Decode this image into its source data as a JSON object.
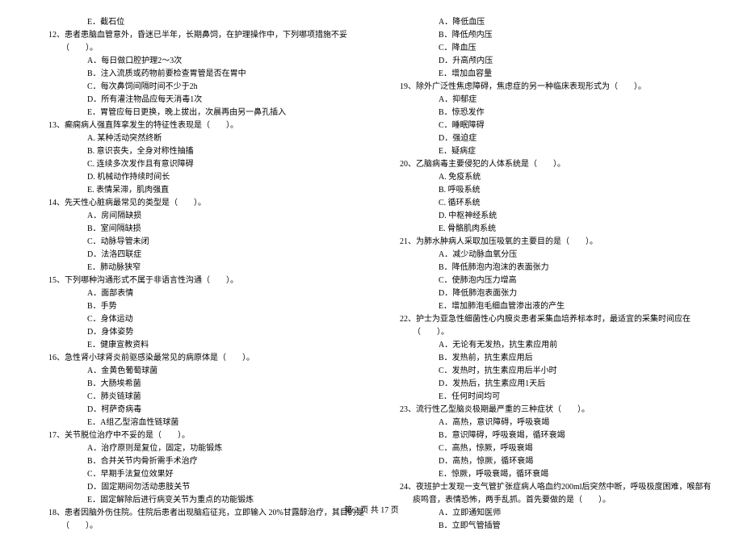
{
  "left": {
    "q11_e": "E．截石位",
    "q12": "12、患者患脑血管意外，昏迷已半年，长期鼻饲，在护理操作中，下列哪项措施不妥（　　）。",
    "q12_a": "A．每日做口腔护理2～3次",
    "q12_b": "B．注入流质或药物前要检查胃管是否在胃中",
    "q12_c": "C．每次鼻饲间隔时间不少于2h",
    "q12_d": "D．所有灌注物品应每天消毒1次",
    "q12_e": "E．胃管应每日更换，晚上拔出，次晨再由另一鼻孔插入",
    "q13": "13、癫痫病人强直阵挛发生的特征性表现是（　　）。",
    "q13_a": "A. 某种活动突然终断",
    "q13_b": "B. 意识丧失，全身对称性抽搐",
    "q13_c": "C. 连续多次发作且有意识障碍",
    "q13_d": "D. 机械动作持续时间长",
    "q13_e": "E. 表情呆滞，肌肉强直",
    "q14": "14、先天性心脏病最常见的类型是（　　）。",
    "q14_a": "A．房间隔缺损",
    "q14_b": "B．室间隔缺损",
    "q14_c": "C．动脉导管未闭",
    "q14_d": "D．法洛四联症",
    "q14_e": "E．肺动脉狭窄",
    "q15": "15、下列哪种沟通形式不属于非语言性沟通（　　）。",
    "q15_a": "A．面部表情",
    "q15_b": "B．手势",
    "q15_c": "C．身体运动",
    "q15_d": "D．身体姿势",
    "q15_e": "E．健康宣教资料",
    "q16": "16、急性肾小球肾炎前驱感染最常见的病原体是（　　）。",
    "q16_a": "A．金黄色葡萄球菌",
    "q16_b": "B．大肠埃希菌",
    "q16_c": "C．肺炎链球菌",
    "q16_d": "D．柯萨奇病毒",
    "q16_e": "E．A组乙型溶血性链球菌",
    "q17": "17、关节脱位治疗中不妥的是（　　）。",
    "q17_a": "A．治疗原则是复位，固定，功能锻炼",
    "q17_b": "B．合并关节内骨折需手术治疗",
    "q17_c": "C．早期手法复位效果好",
    "q17_d": "D．固定期间勿活动患肢关节",
    "q17_e": "E．固定解除后进行病变关节为重点的功能锻炼",
    "q18": "18、患者因脑外伤住院。住院后患者出现脑疝征兆，立即输入 20%甘露醇治疗，其目的是（　　）。"
  },
  "right": {
    "q18_a": "A．降低血压",
    "q18_b": "B．降低颅内压",
    "q18_c": "C．降血压",
    "q18_d": "D．升高颅内压",
    "q18_e": "E．增加血容量",
    "q19": "19、除外广泛性焦虑障碍，焦虑症的另一种临床表现形式为（　　）。",
    "q19_a": "A．抑郁症",
    "q19_b": "B．惊恐发作",
    "q19_c": "C．睡眠障碍",
    "q19_d": "D．强迫症",
    "q19_e": "E．疑病症",
    "q20": "20、乙脑病毒主要侵犯的人体系统是（　　）。",
    "q20_a": "A. 免疫系统",
    "q20_b": "B. 呼吸系统",
    "q20_c": "C. 循环系统",
    "q20_d": "D. 中枢神经系统",
    "q20_e": "E. 骨骼肌肉系统",
    "q21": "21、为肺水肿病人采取加压吸氧的主要目的是（　　）。",
    "q21_a": "A．减少动脉血氧分压",
    "q21_b": "B．降低肺泡内泡沫的表面张力",
    "q21_c": "C．使肺泡内压力增高",
    "q21_d": "D．降低肺泡表面张力",
    "q21_e": "E．增加肺泡毛细血管渗出液的产生",
    "q22": "22、护士为亚急性细菌性心内膜炎患者采集血培养标本时，最适宜的采集时间应在（　　）。",
    "q22_a": "A．无论有无发热，抗生素应用前",
    "q22_b": "B．发热前，抗生素应用后",
    "q22_c": "C．发热时，抗生素应用后半小时",
    "q22_d": "D．发热后，抗生素应用1天后",
    "q22_e": "E．任何时间均可",
    "q23": "23、流行性乙型脑炎极期最严重的三种症状（　　）。",
    "q23_a": "A．高热，意识障碍，呼吸衰竭",
    "q23_b": "B．意识障碍，呼吸衰竭，循环衰竭",
    "q23_c": "C．高热，惊厥，呼吸衰竭",
    "q23_d": "D．高热，惊厥，循环衰竭",
    "q23_e": "E．惊厥，呼吸衰竭，循环衰竭",
    "q24": "24、夜班护士发现一支气管扩张症病人咯血约200ml后突然中断，呼吸极度困难，喉部有痰鸣音，表情恐怖，两手乱抓。首先要做的是（　　）。",
    "q24_a": "A．立即通知医师",
    "q24_b": "B．立即气管插管"
  },
  "footer": "第 2 页 共 17 页"
}
